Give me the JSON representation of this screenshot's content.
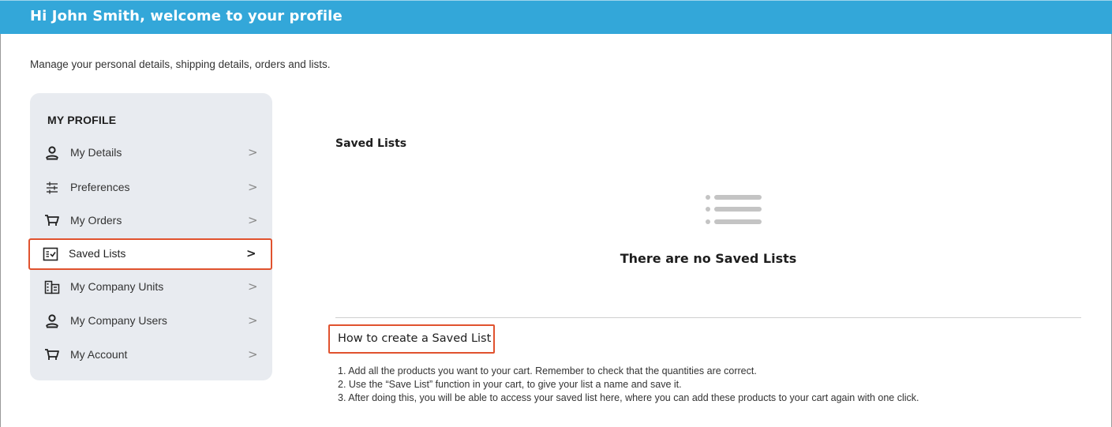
{
  "header": {
    "title": "Hi John Smith, welcome to your profile"
  },
  "subtitle": "Manage your personal details, shipping details, orders and lists.",
  "sidebar": {
    "title": "MY PROFILE",
    "items": [
      {
        "label": "My Details",
        "icon": "user-icon",
        "chevron": ">"
      },
      {
        "label": "Preferences",
        "icon": "sliders-icon",
        "chevron": ">"
      },
      {
        "label": "My Orders",
        "icon": "cart-icon",
        "chevron": ">"
      },
      {
        "label": "Saved Lists",
        "icon": "checklist-icon",
        "chevron": ">",
        "active": true
      },
      {
        "label": "My Company Units",
        "icon": "building-icon",
        "chevron": ">"
      },
      {
        "label": "My Company Users",
        "icon": "user-icon",
        "chevron": ">"
      },
      {
        "label": "My Account",
        "icon": "cart-icon",
        "chevron": ">"
      }
    ]
  },
  "main": {
    "section_title": "Saved Lists",
    "empty_icon": "list-icon",
    "empty_text": "There are no Saved Lists",
    "howto_title": "How to create a Saved List",
    "steps": [
      "1. Add all the products you want to your cart. Remember to check that the quantities are correct.",
      "2. Use the “Save List” function in your cart, to give your list a name and save it.",
      "3. After doing this, you will be able to access your saved list here, where you can add these products to your cart again with one click."
    ]
  },
  "colors": {
    "header_bg": "#33a7d9",
    "sidebar_bg": "#e8ebf0",
    "highlight_border": "#e0522e"
  }
}
